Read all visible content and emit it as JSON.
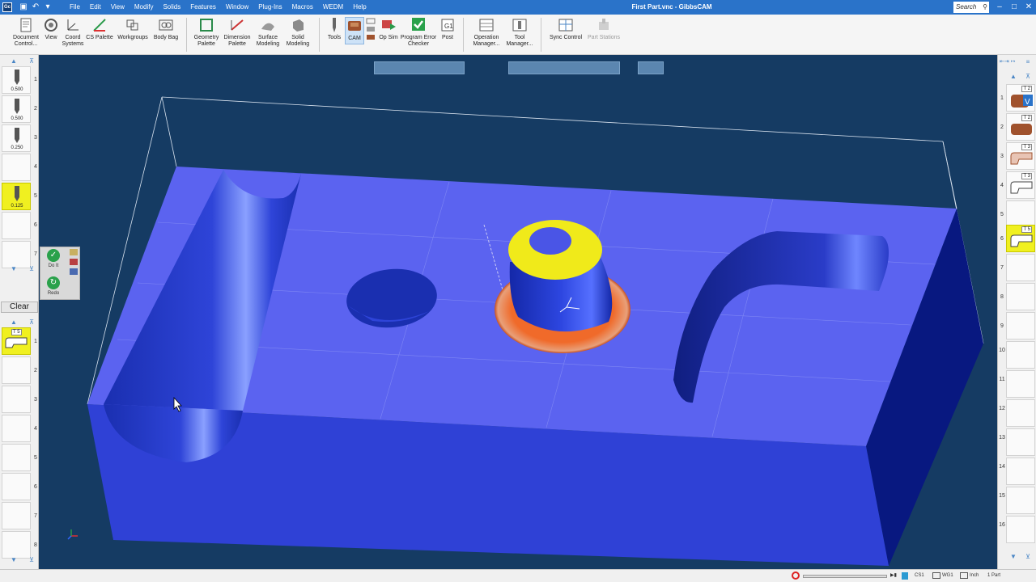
{
  "app": {
    "icon_text": "Gc",
    "title": "First Part.vnc - GibbsCAM"
  },
  "menu": [
    "File",
    "Edit",
    "View",
    "Modify",
    "Solids",
    "Features",
    "Window",
    "Plug-Ins",
    "Macros",
    "WEDM",
    "Help"
  ],
  "search": {
    "placeholder": "Search"
  },
  "ribbon": {
    "document_control": "Document Control...",
    "view": "View",
    "coord_systems": "Coord Systems",
    "cs_palette": "CS Palette",
    "workgroups": "Workgroups",
    "body_bag": "Body Bag",
    "geometry_palette": "Geometry Palette",
    "dimension_palette": "Dimension Palette",
    "surface_modeling": "Surface Modeling",
    "solid_modeling": "Solid Modeling",
    "tools": "Tools",
    "cam": "CAM",
    "op_sim": "Op Sim",
    "program_error_checker": "Program Error Checker",
    "post": "Post",
    "operation_manager": "Operation Manager...",
    "tool_manager": "Tool Manager...",
    "sync_control": "Sync Control",
    "part_stations": "Part Stations"
  },
  "left_tools": [
    {
      "slot": "1",
      "value": "0.500"
    },
    {
      "slot": "2",
      "value": "0.500"
    },
    {
      "slot": "3",
      "value": "0.250"
    },
    {
      "slot": "4",
      "value": ""
    },
    {
      "slot": "5",
      "value": "0.125"
    },
    {
      "slot": "6",
      "value": ""
    },
    {
      "slot": "7",
      "value": ""
    }
  ],
  "process": {
    "clear_label": "Clear",
    "do_it_label": "Do It",
    "redo_label": "Redo",
    "process_tile_tag": "T 5",
    "process_rows": [
      "1",
      "2",
      "3",
      "4",
      "5",
      "6",
      "7",
      "8"
    ]
  },
  "right_ops": [
    {
      "num": "1",
      "tag": "T 2"
    },
    {
      "num": "2",
      "tag": "T 2"
    },
    {
      "num": "3",
      "tag": "T 3"
    },
    {
      "num": "4",
      "tag": "T 3"
    },
    {
      "num": "5",
      "tag": ""
    },
    {
      "num": "6",
      "tag": "T 5"
    },
    {
      "num": "7",
      "tag": ""
    },
    {
      "num": "8",
      "tag": ""
    },
    {
      "num": "9",
      "tag": ""
    },
    {
      "num": "10",
      "tag": ""
    },
    {
      "num": "11",
      "tag": ""
    },
    {
      "num": "12",
      "tag": ""
    },
    {
      "num": "13",
      "tag": ""
    },
    {
      "num": "14",
      "tag": ""
    },
    {
      "num": "15",
      "tag": ""
    },
    {
      "num": "16",
      "tag": ""
    }
  ],
  "status": {
    "cs": "CS1",
    "wg": "WG1",
    "units": "Inch",
    "parts": "1 Part"
  },
  "colors": {
    "titlebar": "#2a73c9",
    "viewport_bg": "#153b63",
    "part_top": "#5b63f0",
    "part_front": "#2f41d6",
    "boss_cap": "#f0ea1a",
    "boss_ring": "#f06a2a",
    "selection_yellow": "#f0f020"
  }
}
